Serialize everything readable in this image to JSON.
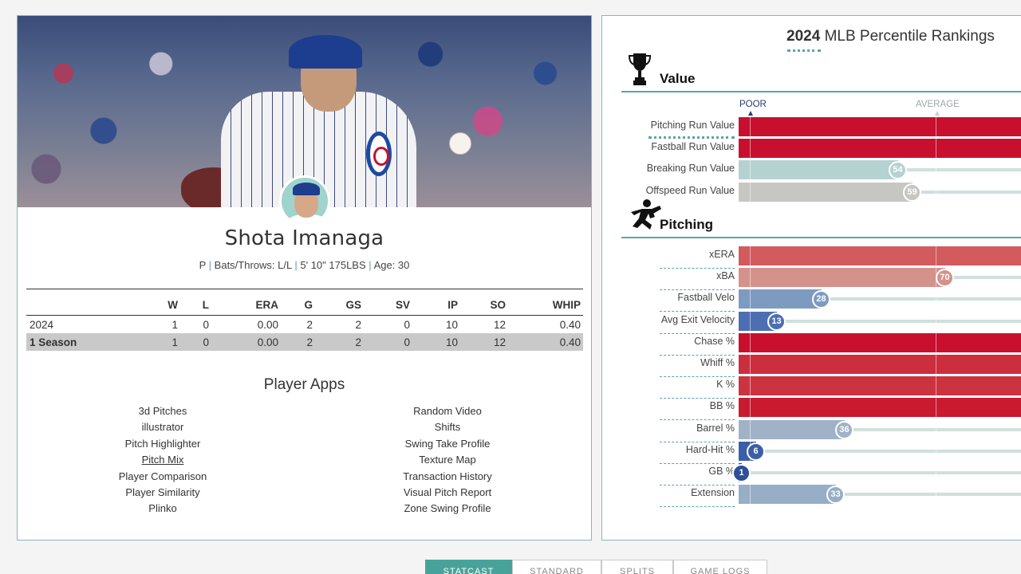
{
  "player": {
    "name": "Shota Imanaga",
    "position": "P",
    "bats_throws": "Bats/Throws: L/L",
    "height_weight": "5' 10\" 175LBS",
    "age": "Age: 30"
  },
  "stats": {
    "columns": [
      "",
      "W",
      "L",
      "ERA",
      "G",
      "GS",
      "SV",
      "IP",
      "SO",
      "WHIP"
    ],
    "rows": [
      [
        "2024",
        "1",
        "0",
        "0.00",
        "2",
        "2",
        "0",
        "10",
        "12",
        "0.40"
      ],
      [
        "1 Season",
        "1",
        "0",
        "0.00",
        "2",
        "2",
        "0",
        "10",
        "12",
        "0.40"
      ]
    ]
  },
  "apps": {
    "title": "Player Apps",
    "left": [
      "3d Pitches",
      "illustrator",
      "Pitch Highlighter",
      "Pitch Mix",
      "Player Comparison",
      "Player Similarity",
      "Plinko"
    ],
    "right": [
      "Random Video",
      "Shifts",
      "Swing Take Profile",
      "Texture Map",
      "Transaction History",
      "Visual Pitch Report",
      "Zone Swing Profile"
    ],
    "active": "Pitch Mix"
  },
  "rankings": {
    "year": "2024",
    "title": "MLB Percentile Rankings",
    "scale": {
      "poor": "POOR",
      "average": "AVERAGE"
    },
    "sections": [
      {
        "name": "Value",
        "icon": "trophy-icon",
        "metrics": [
          {
            "label": "Pitching Run Value",
            "percentile": 100,
            "color": "#c8102e",
            "badge": ""
          },
          {
            "label": "Fastball Run Value",
            "percentile": 100,
            "color": "#c8102e",
            "badge": ""
          },
          {
            "label": "Breaking Run Value",
            "percentile": 54,
            "color": "#b5d2d1",
            "badge": "54"
          },
          {
            "label": "Offspeed Run Value",
            "percentile": 59,
            "color": "#c6c7c3",
            "badge": "59"
          }
        ]
      },
      {
        "name": "Pitching",
        "icon": "pitcher-icon",
        "metrics": [
          {
            "label": "xERA",
            "percentile": 100,
            "color": "#d35b5d",
            "badge": ""
          },
          {
            "label": "xBA",
            "percentile": 70,
            "color": "#d4928b",
            "badge": "70"
          },
          {
            "label": "Fastball Velo",
            "percentile": 28,
            "color": "#7d9bc1",
            "badge": "28"
          },
          {
            "label": "Avg Exit Velocity",
            "percentile": 13,
            "color": "#4c6fb4",
            "badge": "13"
          },
          {
            "label": "Chase %",
            "percentile": 100,
            "color": "#c8102e",
            "badge": ""
          },
          {
            "label": "Whiff %",
            "percentile": 100,
            "color": "#cc2e3e",
            "badge": ""
          },
          {
            "label": "K %",
            "percentile": 100,
            "color": "#cc3340",
            "badge": ""
          },
          {
            "label": "BB %",
            "percentile": 100,
            "color": "#c91a30",
            "badge": ""
          },
          {
            "label": "Barrel %",
            "percentile": 36,
            "color": "#9fb2c7",
            "badge": "36"
          },
          {
            "label": "Hard-Hit %",
            "percentile": 6,
            "color": "#3a5ea8",
            "badge": "6"
          },
          {
            "label": "GB %",
            "percentile": 1,
            "color": "#2d4e9a",
            "badge": "1"
          },
          {
            "label": "Extension",
            "percentile": 33,
            "color": "#97aec6",
            "badge": "33"
          }
        ]
      }
    ]
  },
  "bottom_tabs": [
    "STATCAST",
    "STANDARD",
    "SPLITS",
    "GAME LOGS"
  ]
}
